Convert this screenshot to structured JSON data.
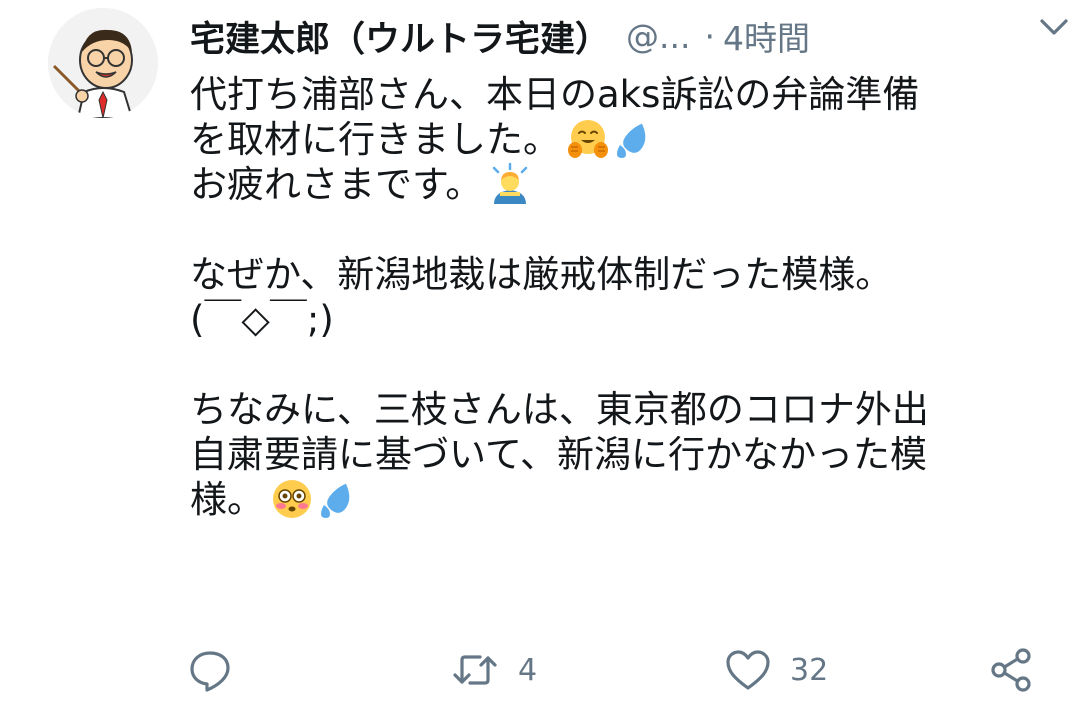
{
  "tweet": {
    "display_name": "宅建太郎（ウルトラ宅建）",
    "handle": "@...",
    "separator": "·",
    "time": "4時間",
    "lines": [
      "代打ち浦部さん、本日のaks訴訟の弁論準備",
      "を取材に行きました。",
      "お疲れさまです。",
      "",
      "なぜか、新潟地裁は厳戒体制だった模様。",
      "(￣◇￣;)",
      "",
      "ちなみに、三枝さんは、東京都のコロナ外出",
      "自粛要請に基づいて、新潟に行かなかった模",
      "様。"
    ],
    "emojis": {
      "line2": [
        "hugging-face-emoji",
        "sweat-droplets-emoji"
      ],
      "line3": [
        "person-bowing-emoji"
      ],
      "line10": [
        "flushed-face-emoji",
        "sweat-droplets-emoji"
      ]
    }
  },
  "actions": {
    "reply_count": "",
    "retweet_count": "4",
    "like_count": "32"
  },
  "colors": {
    "text": "#14171a",
    "muted": "#657786",
    "icon": "#657786",
    "emoji_yellow": "#ffcc4d",
    "emoji_blue": "#5dadec"
  }
}
